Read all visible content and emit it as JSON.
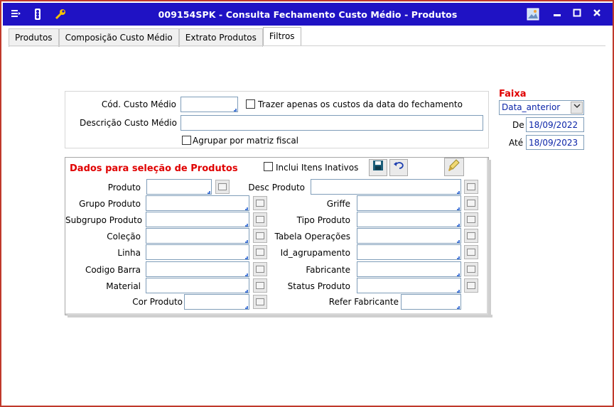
{
  "window": {
    "title": "009154SPK - Consulta Fechamento Custo Médio - Produtos",
    "icons": [
      "menu-list-icon",
      "traffic-light-icon",
      "wrench-icon",
      "image-icon"
    ],
    "buttons": [
      "minimize",
      "maximize",
      "close"
    ]
  },
  "tabs": [
    {
      "label": "Produtos",
      "active": false
    },
    {
      "label": "Composição Custo Médio",
      "active": false
    },
    {
      "label": "Extrato Produtos",
      "active": false
    },
    {
      "label": "Filtros",
      "active": true
    }
  ],
  "top_panel": {
    "cod_label": "Cód. Custo Médio",
    "cod_value": "",
    "trazer_label": "Trazer apenas os custos da data do fechamento",
    "desc_label": "Descrição Custo Médio",
    "desc_value": "",
    "agrupar_label": "Agrupar por matriz fiscal"
  },
  "faixa": {
    "label": "Faixa",
    "selected": "Data_anterior",
    "de_label": "De",
    "de_value": "18/09/2022",
    "ate_label": "Até",
    "ate_value": "18/09/2023"
  },
  "produtos": {
    "title": "Dados para seleção de Produtos",
    "inclui_label": "Inclui Itens Inativos",
    "left_fields": [
      "Produto",
      "Grupo Produto",
      "Subgrupo Produto",
      "Coleção",
      "Linha",
      "Codigo Barra",
      "Material",
      "Cor Produto"
    ],
    "right_fields": [
      "Desc Produto",
      "Griffe",
      "Tipo Produto",
      "Tabela Operações",
      "Id_agrupamento",
      "Fabricante",
      "Status Produto",
      "Refer Fabricante"
    ]
  }
}
